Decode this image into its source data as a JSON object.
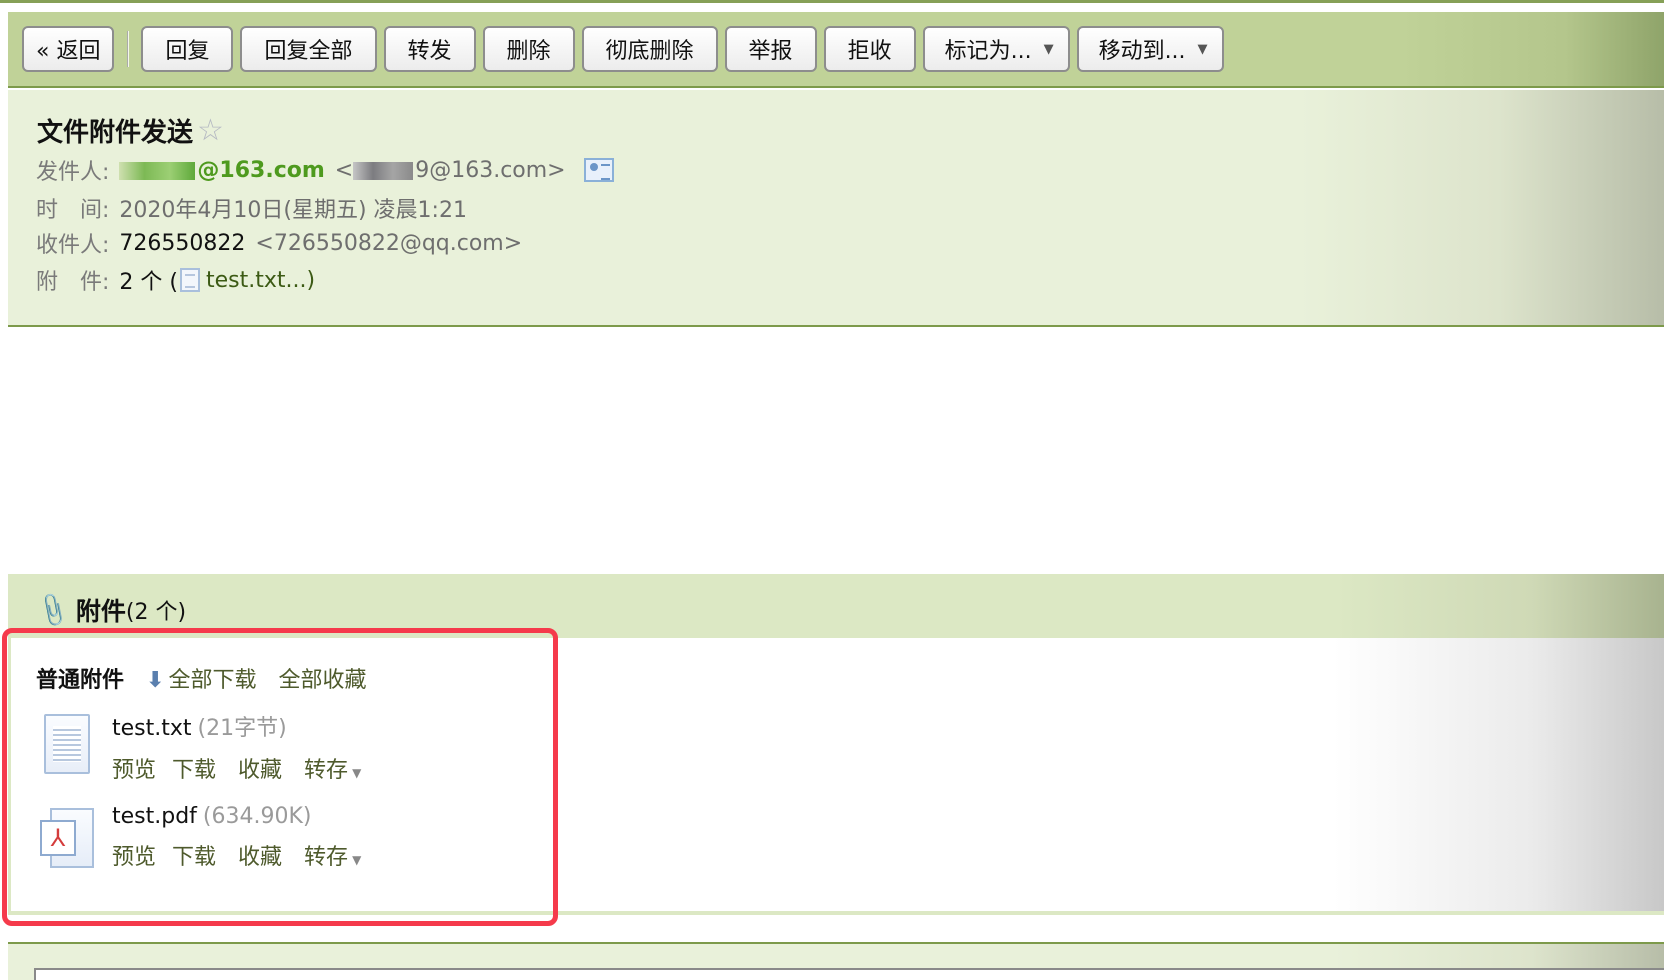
{
  "toolbar": {
    "buttons": [
      {
        "id": "back",
        "label": "« 返回"
      },
      {
        "id": "reply",
        "label": "回复"
      },
      {
        "id": "reply_all",
        "label": "回复全部"
      },
      {
        "id": "forward",
        "label": "转发"
      },
      {
        "id": "delete",
        "label": "删除"
      },
      {
        "id": "delete_permanent",
        "label": "彻底删除"
      },
      {
        "id": "report",
        "label": "举报"
      },
      {
        "id": "reject",
        "label": "拒收"
      },
      {
        "id": "mark_as",
        "label": "标记为...",
        "caret": "▼"
      },
      {
        "id": "move_to",
        "label": "移动到...",
        "caret": "▼"
      }
    ]
  },
  "mail": {
    "subject": "文件附件发送",
    "star_icon": "☆",
    "sender_label": "发件人:",
    "sender_name_suffix": "@163.com",
    "sender_addr_suffix": "9@163.com>",
    "sender_addr_prefix": "<",
    "time_label": "时　间:",
    "time_value": "2020年4月10日(星期五) 凌晨1:21",
    "recipient_label": "收件人:",
    "recipient_name": "726550822",
    "recipient_addr": "<726550822@qq.com>",
    "attachment_label": "附　件:",
    "attachment_count": "2 个 (",
    "attachment_first": "test.txt...)"
  },
  "attachments": {
    "title": "附件",
    "count": "(2 个)",
    "section_label": "普通附件",
    "download_all_arrow": "⬇",
    "download_all": "全部下载",
    "collect_all": "全部收藏",
    "files": [
      {
        "name": "test.txt",
        "size": "(21字节)",
        "type": "txt",
        "actions": {
          "preview": "预览",
          "download": "下载",
          "collect": "收藏",
          "save_to": "转存"
        }
      },
      {
        "name": "test.pdf",
        "size": "(634.90K)",
        "type": "pdf",
        "actions": {
          "preview": "预览",
          "download": "下载",
          "collect": "收藏",
          "save_to": "转存"
        }
      }
    ]
  },
  "colors": {
    "toolbar_bg": "#c0d298",
    "header_bg": "#e9f1da",
    "sender_green": "#4e9a1e",
    "link_olive": "#4e5a2c",
    "highlight_red": "#f53a4b"
  }
}
